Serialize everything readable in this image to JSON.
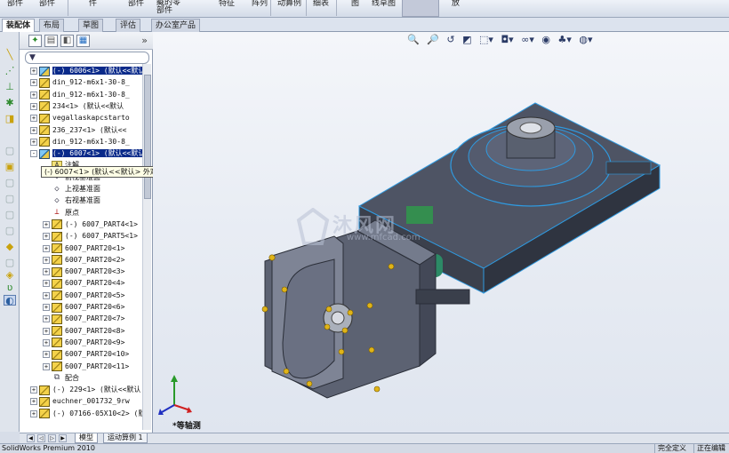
{
  "ribbon": {
    "items": [
      "部件",
      "部件",
      "件",
      "部件",
      "藏的零\n部件",
      "特征",
      "阵列",
      "动算例",
      "细表",
      "图",
      "线草图",
      "放"
    ]
  },
  "command_tabs": [
    "装配体",
    "布局",
    "草图",
    "评估",
    "办公室产品"
  ],
  "panel": {
    "filter_text": "▼",
    "expand_more": "»"
  },
  "tree": {
    "rows": [
      {
        "text": "(-) 6006<1> (默认<<默认",
        "level": 0,
        "icon": "sub",
        "exp": "+",
        "selected": true
      },
      {
        "text": "din_912-m6x1-30-8_",
        "level": 0,
        "icon": "part",
        "exp": "+",
        "selected": false
      },
      {
        "text": "din_912-m6x1-30-8_",
        "level": 0,
        "icon": "part",
        "exp": "+",
        "selected": false
      },
      {
        "text": "234<1> (默认<<默认",
        "level": 0,
        "icon": "part",
        "exp": "+",
        "selected": false
      },
      {
        "text": "vegallaskapcstarto",
        "level": 0,
        "icon": "part",
        "exp": "+",
        "selected": false
      },
      {
        "text": "236_237<1> (默认<<",
        "level": 0,
        "icon": "part",
        "exp": "+",
        "selected": false
      },
      {
        "text": "din_912-m6x1-30-8_",
        "level": 0,
        "icon": "part",
        "exp": "+",
        "selected": false
      },
      {
        "text": "(-) 6007<1> (默认<<默认",
        "level": 0,
        "icon": "sub",
        "exp": "-",
        "selected": true
      },
      {
        "text": "注解",
        "level": 1,
        "icon": "note",
        "exp": "",
        "selected": false
      },
      {
        "text": "前视基准面",
        "level": 1,
        "icon": "plane",
        "exp": "",
        "selected": false
      },
      {
        "text": "上视基准面",
        "level": 1,
        "icon": "plane",
        "exp": "",
        "selected": false
      },
      {
        "text": "右视基准面",
        "level": 1,
        "icon": "plane",
        "exp": "",
        "selected": false
      },
      {
        "text": "原点",
        "level": 1,
        "icon": "origin",
        "exp": "",
        "selected": false
      },
      {
        "text": "(-) 6007_PART4<1> (",
        "level": 1,
        "icon": "part",
        "exp": "+",
        "selected": false
      },
      {
        "text": "(-) 6007_PART5<1> (",
        "level": 1,
        "icon": "part",
        "exp": "+",
        "selected": false
      },
      {
        "text": "6007_PART20<1>",
        "level": 1,
        "icon": "part",
        "exp": "+",
        "selected": false
      },
      {
        "text": "6007_PART20<2>",
        "level": 1,
        "icon": "part",
        "exp": "+",
        "selected": false
      },
      {
        "text": "6007_PART20<3>",
        "level": 1,
        "icon": "part",
        "exp": "+",
        "selected": false
      },
      {
        "text": "6007_PART20<4>",
        "level": 1,
        "icon": "part",
        "exp": "+",
        "selected": false
      },
      {
        "text": "6007_PART20<5>",
        "level": 1,
        "icon": "part",
        "exp": "+",
        "selected": false
      },
      {
        "text": "6007_PART20<6>",
        "level": 1,
        "icon": "part",
        "exp": "+",
        "selected": false
      },
      {
        "text": "6007_PART20<7>",
        "level": 1,
        "icon": "part",
        "exp": "+",
        "selected": false
      },
      {
        "text": "6007_PART20<8>",
        "level": 1,
        "icon": "part",
        "exp": "+",
        "selected": false
      },
      {
        "text": "6007_PART20<9>",
        "level": 1,
        "icon": "part",
        "exp": "+",
        "selected": false
      },
      {
        "text": "6007_PART20<10>",
        "level": 1,
        "icon": "part",
        "exp": "+",
        "selected": false
      },
      {
        "text": "6007_PART20<11>",
        "level": 1,
        "icon": "part",
        "exp": "+",
        "selected": false
      },
      {
        "text": "配合",
        "level": 1,
        "icon": "mate",
        "exp": "",
        "selected": false
      },
      {
        "text": "(-) 229<1> (默认<<默认",
        "level": 0,
        "icon": "part",
        "exp": "+",
        "selected": false
      },
      {
        "text": "euchner_001732_9rw",
        "level": 0,
        "icon": "part",
        "exp": "+",
        "selected": false
      },
      {
        "text": "(-) 07166-05X10<2> (默",
        "level": 0,
        "icon": "part",
        "exp": "+",
        "selected": false
      }
    ]
  },
  "tooltip": "(-) 6007<1> (默认<<默认> 外观 显示状态>)",
  "bottom_tabs": [
    "模型",
    "运动算例 1"
  ],
  "status": {
    "app": "SolidWorks Premium 2010",
    "state1": "完全定义",
    "state2": "正在编辑"
  },
  "viewport": {
    "view_label": "*等轴测",
    "watermark": "沐风网",
    "watermark_url": "www.mfcad.com"
  },
  "colors": {
    "selection": "#0a2a8a",
    "model_body": "#5c6272",
    "highlight_edge": "#2f9ae0",
    "bolt": "#e0b418"
  }
}
